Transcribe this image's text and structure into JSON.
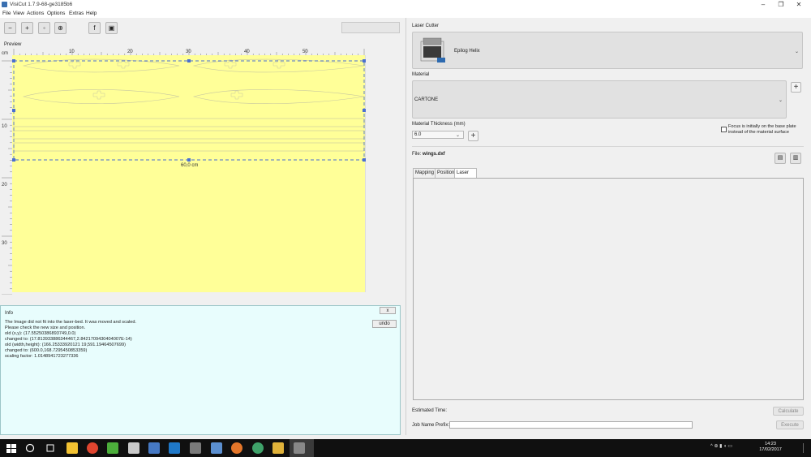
{
  "window": {
    "title": "VisiCut 1.7.9-68-ge3185b6",
    "minimize": "–",
    "restore": "❐",
    "close": "✕"
  },
  "menu": [
    "File",
    "View",
    "Actions",
    "Options",
    "Extras",
    "Help"
  ],
  "toolbar": {
    "buttons": [
      {
        "name": "zoom-out",
        "glyph": "−"
      },
      {
        "name": "zoom-in",
        "glyph": "+"
      },
      {
        "name": "zoom-reset",
        "glyph": "◦"
      },
      {
        "name": "zoom-fit",
        "glyph": "⊕"
      },
      {
        "name": "facebook",
        "glyph": "f"
      },
      {
        "name": "camera",
        "glyph": "▣"
      }
    ]
  },
  "preview": {
    "label": "Preview",
    "unit": "cm",
    "x_ticks": [
      "10",
      "20",
      "30",
      "40",
      "50"
    ],
    "y_ticks": [
      "10",
      "20",
      "30"
    ],
    "selection_label": "60,0 cm",
    "bed_color": "#ffff98",
    "selection_color": "#4a6fd0"
  },
  "info": {
    "title": "Info",
    "close_label": "x",
    "undo_label": "undo",
    "lines": [
      "The Image did not fit into the laser-bed. It was moved and scaled.",
      "Please check the new size and position.",
      "old (x,y): (17.55250386893749,0.0)",
      "changed to: (17.813933886344467,2.8421709430404007E-14)",
      "old (width,height): (166.25333920121 19,591.19464507699)",
      "changed to: (600.0,168.7295450853359)",
      " scaling factor: 1.0148941723277336"
    ]
  },
  "laser_cutter": {
    "label": "Laser Cutter",
    "selected": "Epilog Helix"
  },
  "material": {
    "label": "Material",
    "selected": "CARTONE"
  },
  "thickness": {
    "label": "Material Thickness (mm)",
    "selected": "6.0"
  },
  "focus": {
    "label_line1": "Focus is initially on the base plate",
    "label_line2": "instead of the material surface"
  },
  "file": {
    "label": "File:",
    "name": "wings.dxf"
  },
  "tabs": [
    "Mapping",
    "Position",
    "Laser Settings"
  ],
  "footer": {
    "estimated_time_label": "Estimated Time:",
    "calculate_label": "Calculate",
    "job_prefix_label": "Job Name Prefix:",
    "job_prefix_value": "",
    "execute_label": "Execute"
  },
  "taskbar": {
    "time": "14:23",
    "date": "17/02/2017",
    "tray": "^  ⊕ ▮ ◖ ▭",
    "apps": [
      {
        "name": "start",
        "color": "#ffffff"
      },
      {
        "name": "search",
        "color": "#ffffff"
      },
      {
        "name": "task-view",
        "color": "#ffffff"
      },
      {
        "name": "explorer",
        "color": "#f2c232"
      },
      {
        "name": "chrome",
        "color": "#e0452f"
      },
      {
        "name": "app-green",
        "color": "#4cae3b"
      },
      {
        "name": "app-feather",
        "color": "#c9c9c9"
      },
      {
        "name": "app-blue",
        "color": "#4679c4"
      },
      {
        "name": "app-z",
        "color": "#1f78c8"
      },
      {
        "name": "calculator",
        "color": "#7a7a7a"
      },
      {
        "name": "app-doc",
        "color": "#5b8fd0"
      },
      {
        "name": "firefox",
        "color": "#e4762a"
      },
      {
        "name": "app-globe",
        "color": "#3fa26a"
      },
      {
        "name": "app-gem",
        "color": "#e0b23a"
      },
      {
        "name": "visicut",
        "color": "#888888"
      }
    ]
  }
}
